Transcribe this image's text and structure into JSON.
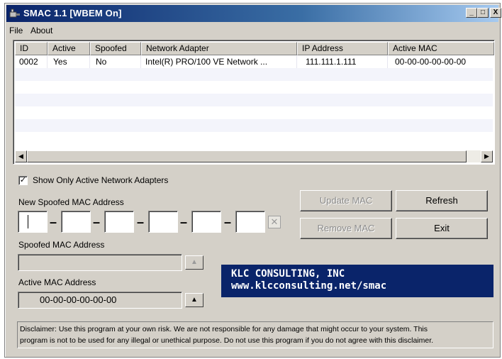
{
  "window": {
    "title": "SMAC 1.1  [WBEM On]",
    "controls": {
      "minimize": "_",
      "maximize": "□",
      "close": "X"
    }
  },
  "menu": {
    "file": "File",
    "about": "About"
  },
  "adapters_table": {
    "columns": [
      "ID",
      "Active",
      "Spoofed",
      "Network Adapter",
      "IP Address",
      "Active MAC"
    ],
    "rows": [
      {
        "id": "0002",
        "active": "Yes",
        "spoofed": "No",
        "adapter": "Intel(R) PRO/100 VE Network ...",
        "ip": "111.111.1.111",
        "mac": "00-00-00-00-00-00"
      }
    ]
  },
  "options": {
    "show_only_active_label": "Show Only Active Network Adapters",
    "show_only_active_checked": "✓"
  },
  "new_mac": {
    "label": "New Spoofed MAC Address",
    "separator": "–",
    "clear_glyph": "✕"
  },
  "buttons": {
    "update_mac": "Update MAC",
    "refresh": "Refresh",
    "remove_mac": "Remove MAC",
    "exit": "Exit",
    "up_arrow": "▲"
  },
  "spoofed_mac": {
    "label": "Spoofed MAC Address",
    "value": ""
  },
  "active_mac": {
    "label": "Active MAC Address",
    "value": "00-00-00-00-00-00"
  },
  "banner": {
    "line1": "KLC CONSULTING, INC",
    "line2": "www.klcconsulting.net/smac"
  },
  "disclaimer": {
    "line1": "Disclaimer: Use this program at your own risk.  We are not responsible for any damage that might occur to your system.  This",
    "line2": "program is not to be used for any illegal or unethical purpose.  Do not use this program if you do not agree with this disclaimer."
  },
  "scrollbar": {
    "left_arrow": "◀",
    "right_arrow": "▶"
  },
  "colors": {
    "title_bar": "#0a246a",
    "banner_background": "#0a246a",
    "banner_text": "#ffffff",
    "window_face": "#d4d0c8"
  }
}
